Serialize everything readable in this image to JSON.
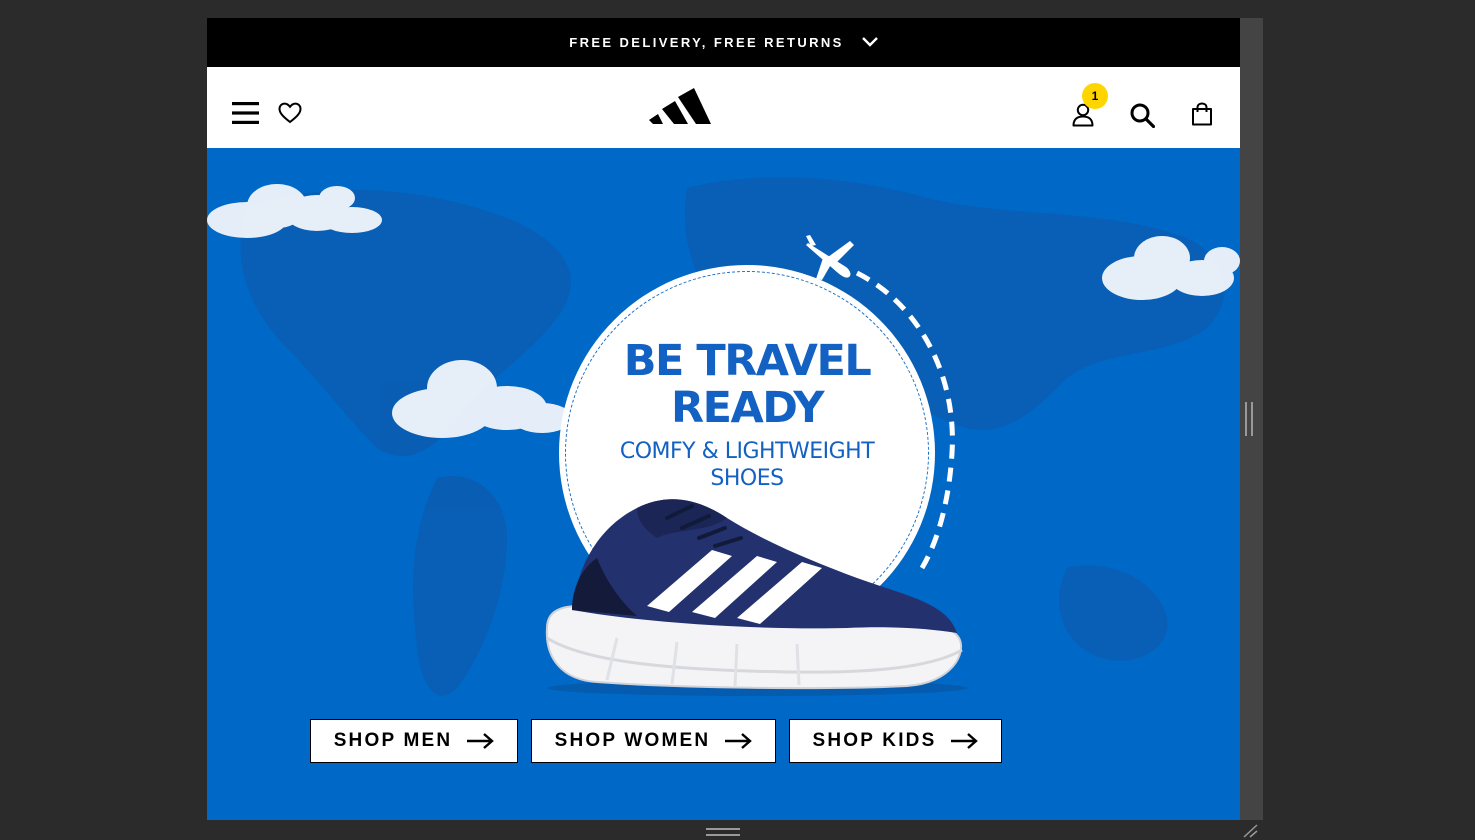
{
  "promo": {
    "text": "FREE DELIVERY, FREE RETURNS",
    "chevron_icon": "chevron-down-icon"
  },
  "header": {
    "menu_icon": "hamburger-menu-icon",
    "wishlist_icon": "heart-icon",
    "logo": "adidas-logo",
    "account_icon": "user-icon",
    "account_badge": "1",
    "search_icon": "search-icon",
    "bag_icon": "shopping-bag-icon"
  },
  "hero": {
    "title_line1": "BE TRAVEL",
    "title_line2": "READY",
    "subtitle_line1": "COMFY & LIGHTWEIGHT",
    "subtitle_line2": "SHOES",
    "image": "navy-running-shoe",
    "colors": {
      "background": "#0068c6",
      "headline": "#1361c2",
      "badge": "#ffd500"
    }
  },
  "cta": [
    {
      "label": "SHOP MEN",
      "icon": "arrow-right-icon"
    },
    {
      "label": "SHOP WOMEN",
      "icon": "arrow-right-icon"
    },
    {
      "label": "SHOP KIDS",
      "icon": "arrow-right-icon"
    }
  ]
}
